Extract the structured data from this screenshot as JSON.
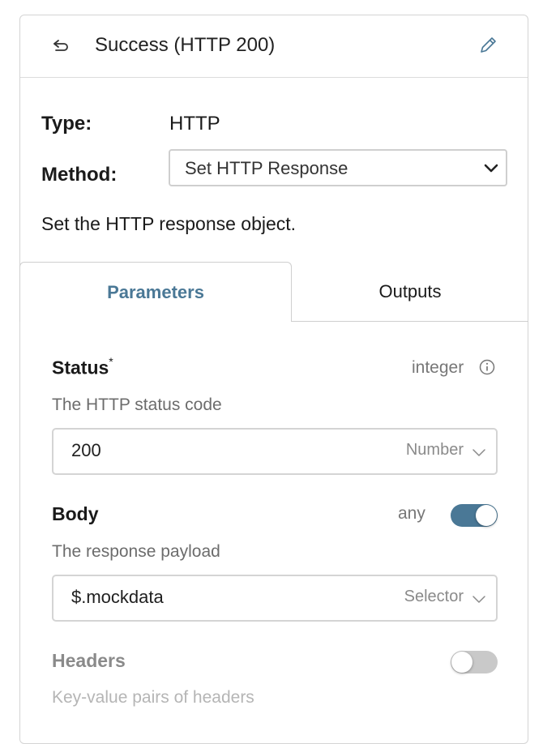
{
  "header": {
    "title": "Success (HTTP 200)",
    "back_icon": "return-arrow-icon",
    "edit_icon": "pencil-icon"
  },
  "details": {
    "type_label": "Type:",
    "type_value": "HTTP",
    "method_label": "Method:",
    "method_selected": "Set HTTP Response",
    "description": "Set the HTTP response object."
  },
  "tabs": [
    {
      "label": "Parameters",
      "active": true
    },
    {
      "label": "Outputs",
      "active": false
    }
  ],
  "parameters": {
    "status": {
      "title": "Status",
      "required_mark": "*",
      "type": "integer",
      "description": "The HTTP status code",
      "value": "200",
      "input_kind": "Number"
    },
    "body": {
      "title": "Body",
      "type": "any",
      "toggle_on": true,
      "description": "The response payload",
      "value": "$.mockdata",
      "input_kind": "Selector"
    },
    "headers": {
      "title": "Headers",
      "toggle_on": false,
      "description": "Key-value pairs of headers"
    }
  },
  "colors": {
    "accent": "#4a7896",
    "border": "#d4d4d4",
    "muted_text": "#6c6c6c"
  }
}
